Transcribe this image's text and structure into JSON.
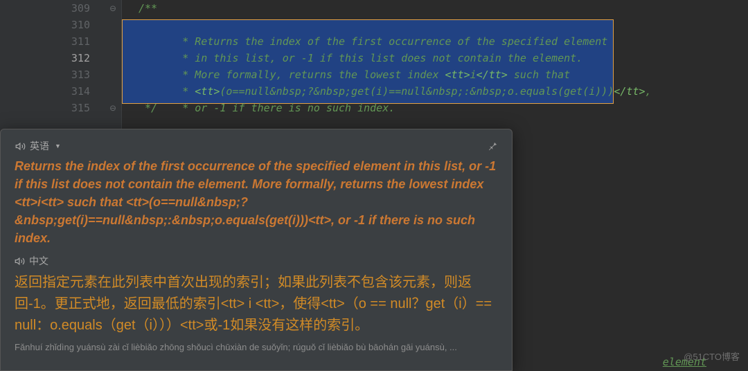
{
  "gutter": {
    "lines": [
      "309",
      "310",
      "311",
      "312",
      "313",
      "314",
      "315"
    ],
    "active_index": 3,
    "fold_open_marker": "⊖",
    "fold_close_marker": "⊖"
  },
  "code": {
    "l0": "/**",
    "l1_pre": " * ",
    "l1_txt": "Returns the index of the first occurrence of the specified element",
    "l2_pre": " * ",
    "l2_txt": "in this list, or -1 if this list does not contain the element.",
    "l3_pre": " * ",
    "l3_txt": "More formally, returns the lowest index ",
    "l3_tag1": "<tt>",
    "l3_mid": "i",
    "l3_tag2": "</tt>",
    "l3_end": " such that",
    "l4_pre": " * ",
    "l4_tag1": "<tt>",
    "l4_body": "(o==null&nbsp;?&nbsp;get(i)==null&nbsp;:&nbsp;o.equals(get(i)))",
    "l4_tag2": "</tt>",
    "l4_end": ",",
    "l5_pre": " * ",
    "l5_txt": "or -1 if there is no such index.",
    "l6": " */",
    "trailing": "element"
  },
  "popup": {
    "lang_en_label": "英语",
    "lang_zh_label": "中文",
    "pin_title": "Pin",
    "speaker_title": "Play",
    "english_text": "Returns the index of the first occurrence of the specified element in this list, or -1 if this list does not contain the element. More formally, returns the lowest index <tt>i<tt> such that <tt>(o==null&nbsp;?&nbsp;get(i)==null&nbsp;:&nbsp;o.equals(get(i)))<tt>, or -1 if there is no such index.",
    "chinese_text": "返回指定元素在此列表中首次出现的索引；如果此列表不包含该元素，则返回-1。更正式地，返回最低的索引<tt> i <tt>，使得<tt>（o == null？get（i）== null：o.equals（get（i）））<tt>或-1如果没有这样的索引。",
    "pinyin": "Fǎnhuí zhǐdìng yuánsù zài cǐ lièbiǎo zhōng shǒucì chūxiàn de suǒyǐn; rúguǒ cǐ lièbiǎo bù bāohán gāi yuánsù, ..."
  },
  "watermark": "@51CTO博客"
}
